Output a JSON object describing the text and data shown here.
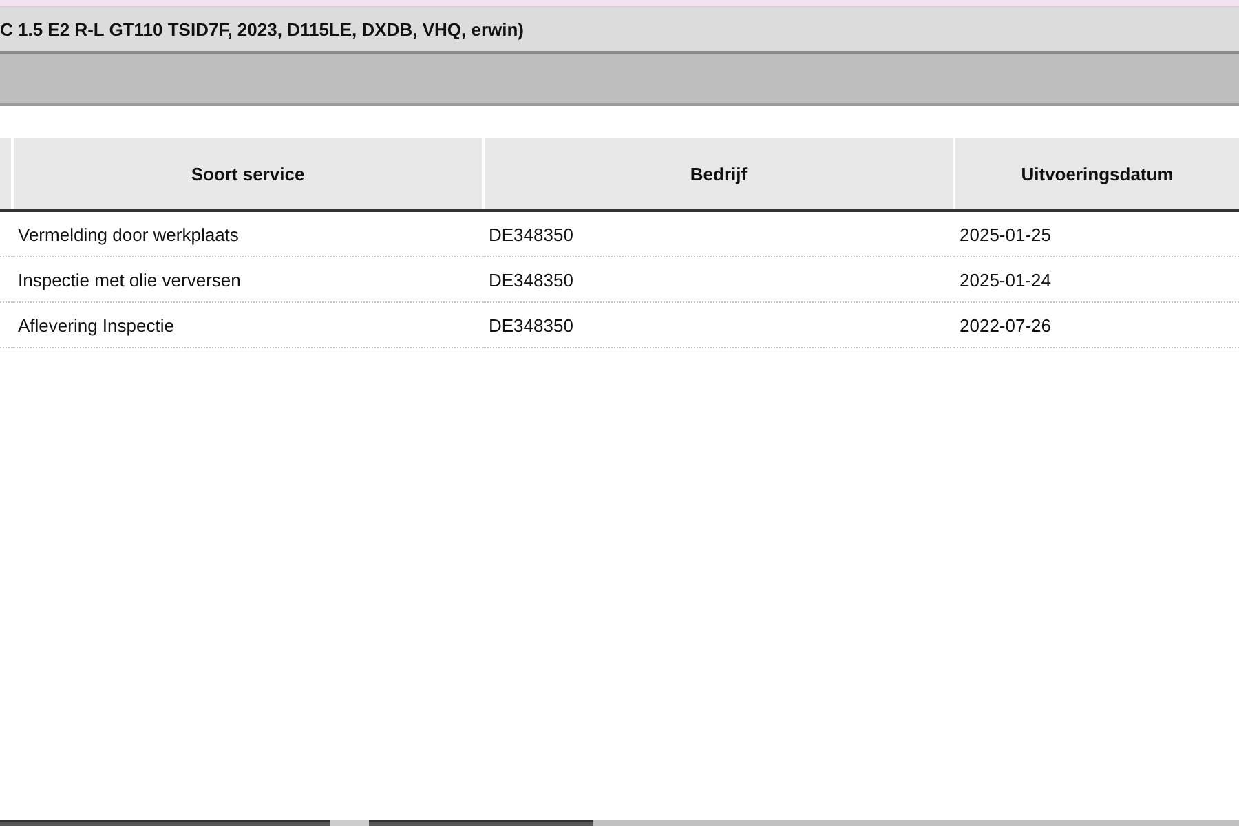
{
  "window": {
    "title": "C 1.5 E2 R-L GT110 TSID7F, 2023, D115LE, DXDB, VHQ, erwin)"
  },
  "table": {
    "columns": [
      "Soort service",
      "Bedrijf",
      "Uitvoeringsdatum"
    ],
    "rows": [
      [
        "Vermelding door werkplaats",
        "DE348350",
        "2025-01-25"
      ],
      [
        "Inspectie met olie verversen",
        "DE348350",
        "2025-01-24"
      ],
      [
        "Aflevering Inspectie",
        "DE348350",
        "2022-07-26"
      ]
    ]
  }
}
